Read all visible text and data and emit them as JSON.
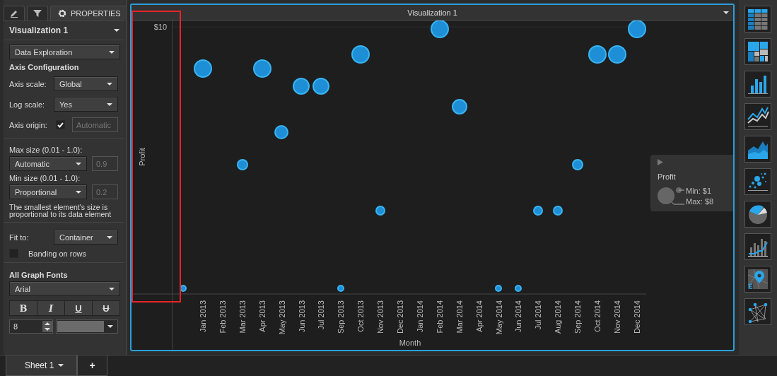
{
  "panel": {
    "tabs": [
      {
        "kind": "pencil",
        "selected": false
      },
      {
        "kind": "filter",
        "selected": false
      },
      {
        "kind": "gear",
        "label": "PROPERTIES",
        "selected": true
      }
    ],
    "title": "Visualization 1",
    "view": "Data Exploration",
    "axis_heading": "Axis Configuration",
    "axis_fields": [
      {
        "kind": "select",
        "label": "Axis scale:",
        "value": "Global"
      },
      {
        "kind": "select",
        "label": "Log scale:",
        "value": "Yes"
      },
      {
        "kind": "check",
        "label": "Axis origin:",
        "checked": true,
        "placeholder": "Automatic"
      }
    ],
    "sizes": [
      {
        "label": "Max size (0.01 - 1.0):",
        "value": "Automatic",
        "placeholder": "0.9"
      },
      {
        "label": "Min size (0.01 - 1.0):",
        "value": "Proportional",
        "placeholder": "0.2",
        "note": "The smallest element's size is proportional to its data element"
      }
    ],
    "fit_to": {
      "label": "Fit to:",
      "value": "Container"
    },
    "banding": {
      "label": "Banding on rows",
      "checked": false
    },
    "fonts_heading": "All Graph Fonts",
    "font_family": "Arial",
    "font_styles": [
      {
        "kind": "bold",
        "label": "B"
      },
      {
        "kind": "italic",
        "label": "I"
      },
      {
        "kind": "underline",
        "label": "U"
      },
      {
        "kind": "strike",
        "label": "U"
      }
    ],
    "font_size": "8"
  },
  "chart": {
    "title": "Visualization 1",
    "y_label": "Profit",
    "y_tick": "$10",
    "x_label": "Month",
    "x_labels": [
      "Jan 2013",
      "Feb 2013",
      "Mar 2013",
      "Apr 2013",
      "May 2013",
      "Jun 2013",
      "Jul 2013",
      "Sep 2013",
      "Oct 2013",
      "Nov 2013",
      "Dec 2013",
      "Jan 2014",
      "Feb 2014",
      "Mar 2014",
      "Apr 2014",
      "May 2014",
      "Jun 2014",
      "Jul 2014",
      "Aug 2014",
      "Sep 2014",
      "Oct 2014",
      "Nov 2014",
      "Dec 2014"
    ],
    "legend": {
      "title": "Profit",
      "min": "Min: $1",
      "max": "Max: $8"
    }
  },
  "toolbar": [
    {
      "kind": "table"
    },
    {
      "kind": "treemap"
    },
    {
      "kind": "bar"
    },
    {
      "kind": "line"
    },
    {
      "kind": "area"
    },
    {
      "kind": "scatter"
    },
    {
      "kind": "pie"
    },
    {
      "kind": "combo"
    },
    {
      "kind": "map"
    },
    {
      "kind": "network"
    }
  ],
  "sheets": [
    {
      "label": "Sheet 1",
      "selected": true
    }
  ],
  "add_sheet": "+"
}
